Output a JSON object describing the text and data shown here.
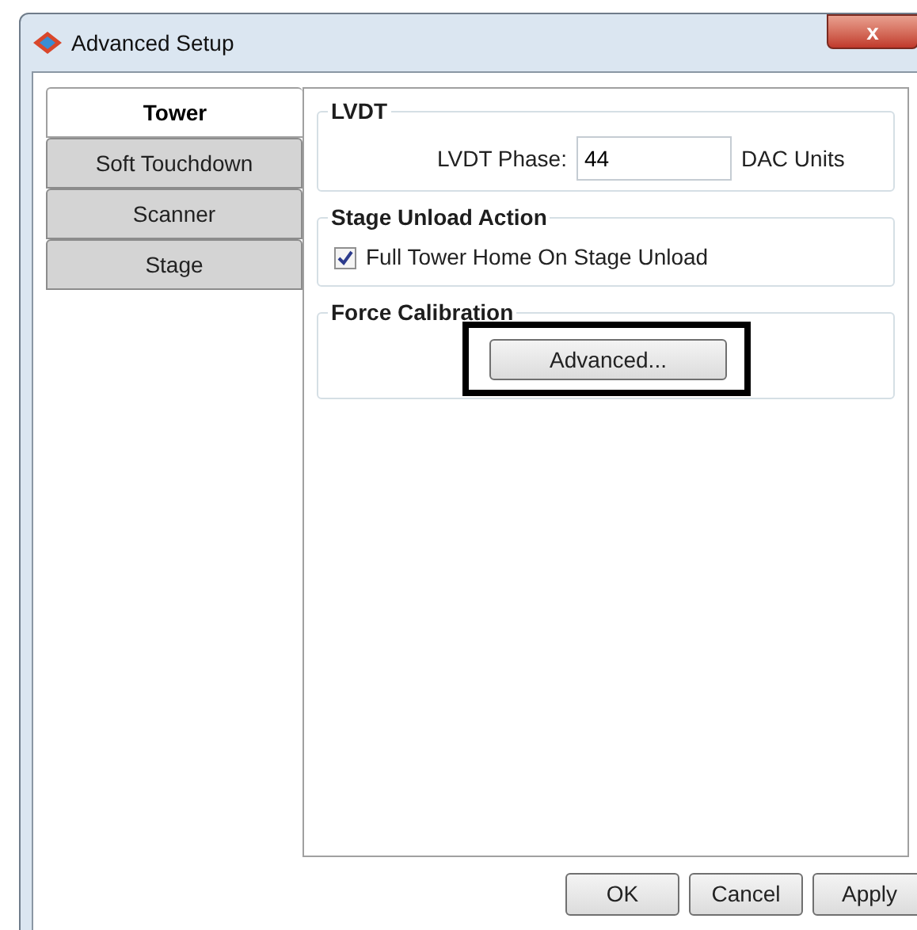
{
  "window": {
    "title": "Advanced Setup",
    "close": "x"
  },
  "tabs": [
    {
      "label": "Tower",
      "selected": true
    },
    {
      "label": "Soft Touchdown",
      "selected": false
    },
    {
      "label": "Scanner",
      "selected": false
    },
    {
      "label": "Stage",
      "selected": false
    }
  ],
  "lvdt": {
    "title": "LVDT",
    "label": "LVDT Phase:",
    "value": "44",
    "unit": "DAC Units"
  },
  "stage_unload": {
    "title": "Stage Unload Action",
    "option": {
      "label": "Full Tower Home On Stage Unload",
      "checked": true
    }
  },
  "force_calibration": {
    "title": "Force Calibration",
    "button": "Advanced...",
    "highlighted": true
  },
  "buttons": [
    "OK",
    "Cancel",
    "Apply"
  ]
}
